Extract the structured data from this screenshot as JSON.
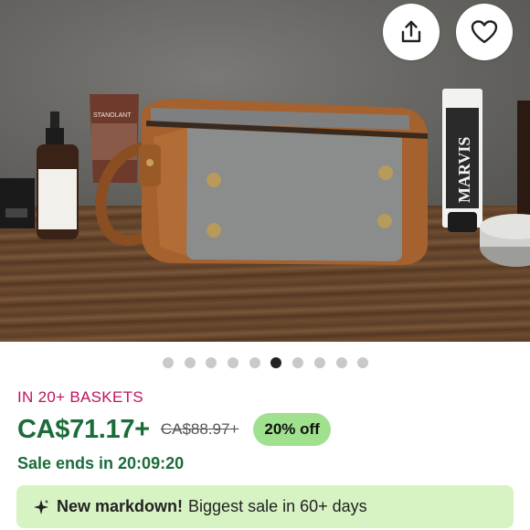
{
  "product_image": {
    "alt": "",
    "marvis_label": "MARVIS",
    "stanolant_label": "STANOLANT",
    "slide_count": 10,
    "active_slide": 6
  },
  "actions": {
    "share_icon": "share-icon",
    "favorite_icon": "heart-icon"
  },
  "listing": {
    "baskets_text": "IN 20+ BASKETS",
    "price": "CA$71.17+",
    "original_price": "CA$88.97+",
    "discount": "20% off",
    "sale_ends": "Sale ends in 20:09:20",
    "markdown_title": "New markdown!",
    "markdown_text": "Biggest sale in 60+ days"
  },
  "colors": {
    "accent_green": "#1b6c3a",
    "basket_pink": "#c1125c",
    "discount_bg": "#9fe18e",
    "banner_bg": "#d7f3c4"
  }
}
